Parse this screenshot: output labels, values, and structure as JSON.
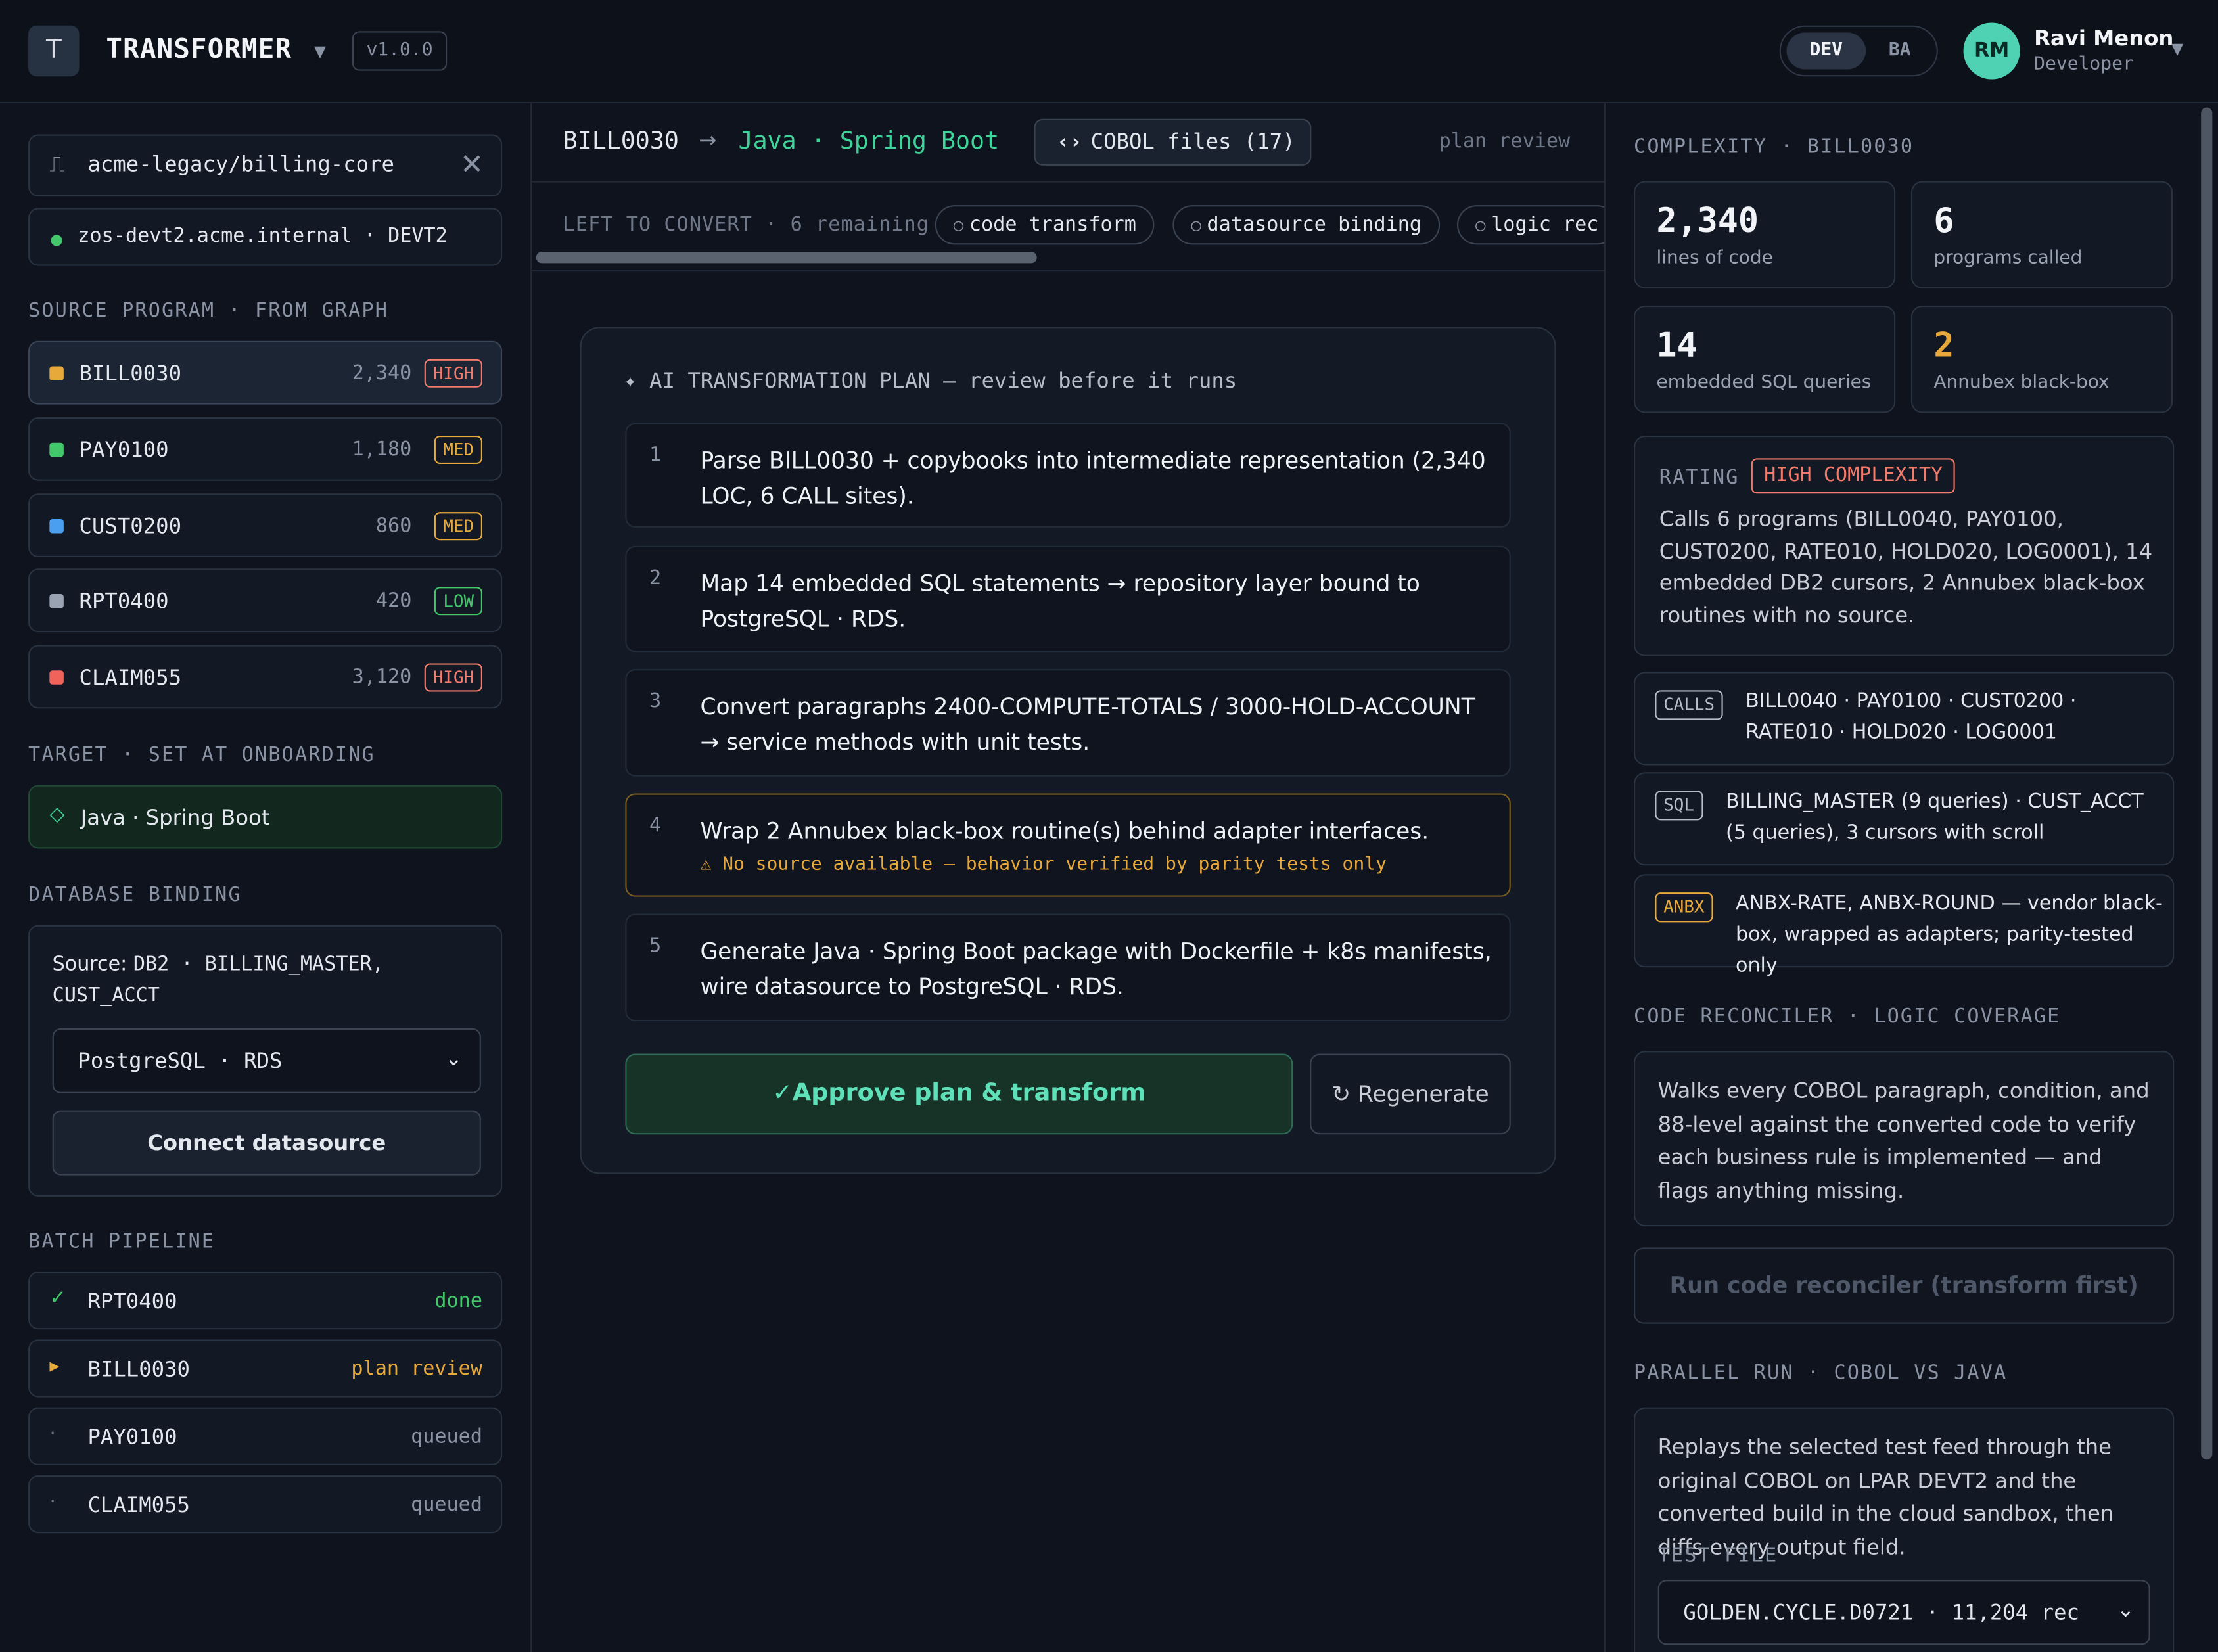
{
  "header": {
    "logo_letter": "T",
    "app_name": "TRANSFORMER",
    "version": "v1.0.0",
    "mode_options": [
      "DEV",
      "BA"
    ],
    "mode_selected": "DEV",
    "user": {
      "initials": "RM",
      "name": "Ravi Menon",
      "role": "Developer"
    }
  },
  "sidebar": {
    "repo": "acme-legacy/billing-core",
    "host": "zos-devt2.acme.internal · DEVT2",
    "source_label": "SOURCE PROGRAM · FROM GRAPH",
    "programs": [
      {
        "name": "BILL0030",
        "loc": "2,340",
        "level": "HIGH",
        "color": "#e8a93b"
      },
      {
        "name": "PAY0100",
        "loc": "1,180",
        "level": "MED",
        "color": "#44c76a"
      },
      {
        "name": "CUST0200",
        "loc": "860",
        "level": "MED",
        "color": "#4a9ff0"
      },
      {
        "name": "RPT0400",
        "loc": "420",
        "level": "LOW",
        "color": "#9aa3b2"
      },
      {
        "name": "CLAIM055",
        "loc": "3,120",
        "level": "HIGH",
        "color": "#f0635a"
      }
    ],
    "target_label": "TARGET · SET AT ONBOARDING",
    "target_value": "Java · Spring Boot",
    "db_label": "DATABASE BINDING",
    "db_source_prefix": "Source:",
    "db_source_value": "DB2 · BILLING_MASTER, CUST_ACCT",
    "db_select": "PostgreSQL · RDS",
    "connect_label": "Connect datasource",
    "pipeline_label": "BATCH PIPELINE",
    "pipeline": [
      {
        "name": "RPT0400",
        "status": "done",
        "icon": "✓"
      },
      {
        "name": "BILL0030",
        "status": "plan review",
        "icon": "▸"
      },
      {
        "name": "PAY0100",
        "status": "queued",
        "icon": "·"
      },
      {
        "name": "CLAIM055",
        "status": "queued",
        "icon": "·"
      }
    ]
  },
  "center": {
    "program_id": "BILL0030",
    "arrow": "→",
    "target": "Java · Spring Boot",
    "cobol_files": "COBOL files (17)",
    "stage": "plan review",
    "left_label": "LEFT TO CONVERT · 6 remaining",
    "chips": [
      "code transform",
      "datasource binding",
      "logic rec"
    ],
    "plan_title": "AI TRANSFORMATION PLAN — review before it runs",
    "steps": [
      {
        "n": "1",
        "text": "Parse BILL0030 + copybooks into intermediate representation (2,340 LOC, 6 CALL sites)."
      },
      {
        "n": "2",
        "text": "Map 14 embedded SQL statements → repository layer bound to PostgreSQL · RDS."
      },
      {
        "n": "3",
        "text": "Convert paragraphs 2400-COMPUTE-TOTALS / 3000-HOLD-ACCOUNT → service methods with unit tests."
      },
      {
        "n": "4",
        "text": "Wrap 2 Annubex black-box routine(s) behind adapter interfaces.",
        "warning": "⚠ No source available — behavior verified by parity tests only"
      },
      {
        "n": "5",
        "text": "Generate Java · Spring Boot package with Dockerfile + k8s manifests, wire datasource to PostgreSQL · RDS."
      }
    ],
    "approve_label": "✓Approve plan & transform",
    "regenerate_label": "↻ Regenerate"
  },
  "right": {
    "complexity_label": "COMPLEXITY · BILL0030",
    "stats": [
      {
        "value": "2,340",
        "label": "lines of code",
        "color": "#f2f4f8"
      },
      {
        "value": "6",
        "label": "programs called",
        "color": "#f2f4f8"
      },
      {
        "value": "14",
        "label": "embedded SQL queries",
        "color": "#f2f4f8"
      },
      {
        "value": "2",
        "label": "Annubex black-box",
        "color": "#e8a93b"
      }
    ],
    "rating_label": "RATING",
    "rating_badge": "HIGH COMPLEXITY",
    "rating_text": "Calls 6 programs (BILL0040, PAY0100, CUST0200, RATE010, HOLD020, LOG0001), 14 embedded DB2 cursors, 2 Annubex black-box routines with no source.",
    "deps": [
      {
        "tag": "CALLS",
        "text": "BILL0040 · PAY0100 · CUST0200 · RATE010 · HOLD020 · LOG0001"
      },
      {
        "tag": "SQL",
        "text": "BILLING_MASTER (9 queries) · CUST_ACCT (5 queries), 3 cursors with scroll"
      },
      {
        "tag": "ANBX",
        "text": "ANBX-RATE, ANBX-ROUND — vendor black-box, wrapped as adapters; parity-tested only"
      }
    ],
    "reconciler_label": "CODE RECONCILER · LOGIC COVERAGE",
    "reconciler_text": "Walks every COBOL paragraph, condition, and 88-level against the converted code to verify each business rule is implemented — and flags anything missing.",
    "reconciler_button": "Run code reconciler (transform first)",
    "parallel_label": "PARALLEL RUN · COBOL VS JAVA",
    "parallel_text": "Replays the selected test feed through the original COBOL on LPAR DEVT2 and the converted build in the cloud sandbox, then diffs every output field.",
    "test_file_label": "TEST FILE",
    "test_file_value": "GOLDEN.CYCLE.D0721 · 11,204 rec"
  }
}
